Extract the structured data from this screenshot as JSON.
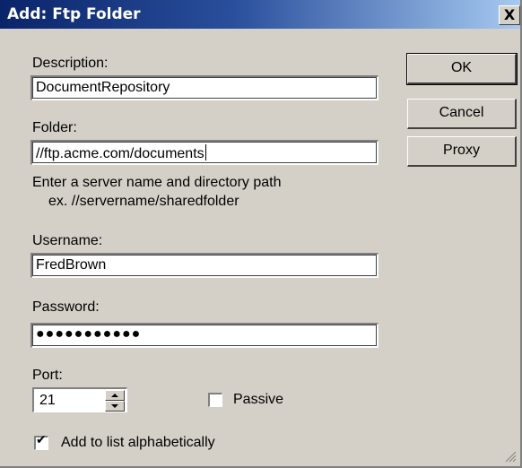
{
  "window": {
    "title": "Add:  Ftp Folder",
    "close_glyph": "X"
  },
  "form": {
    "description": {
      "label": "Description:",
      "value": "DocumentRepository"
    },
    "folder": {
      "label": "Folder:",
      "value": "//ftp.acme.com/documents"
    },
    "hint_line1": "Enter a server name and directory path",
    "hint_line2": "ex. //servername/sharedfolder",
    "username": {
      "label": "Username:",
      "value": "FredBrown"
    },
    "password": {
      "label": "Password:",
      "masked_value": "●●●●●●●●●●●"
    },
    "port": {
      "label": "Port:",
      "value": "21"
    },
    "passive": {
      "label": "Passive",
      "checked": false
    },
    "alphabetical": {
      "label": "Add to list alphabetically",
      "checked": true
    }
  },
  "buttons": {
    "ok": "OK",
    "cancel": "Cancel",
    "proxy": "Proxy"
  },
  "icons": {
    "spin_up": "spin-up-arrow-icon",
    "spin_down": "spin-down-arrow-icon",
    "checkmark": "✔",
    "resize_grip": "resize-grip-icon"
  }
}
